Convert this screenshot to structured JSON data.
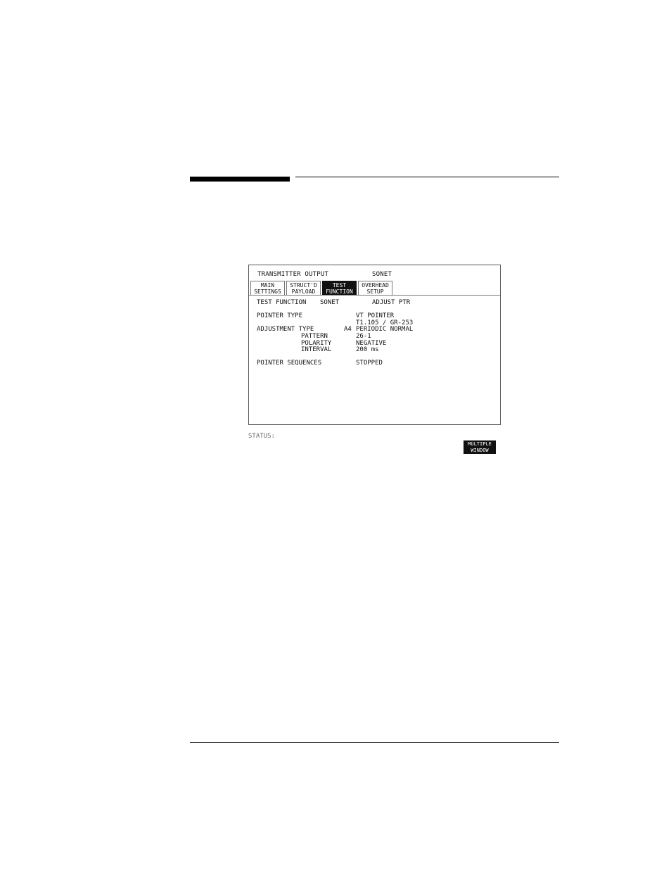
{
  "window": {
    "title": "TRANSMITTER OUTPUT",
    "mode": "SONET"
  },
  "tabs": [
    {
      "line1": "MAIN",
      "line2": "SETTINGS",
      "active": false
    },
    {
      "line1": "STRUCT'D",
      "line2": "PAYLOAD",
      "active": false
    },
    {
      "line1": "TEST",
      "line2": "FUNCTION",
      "active": true
    },
    {
      "line1": "OVERHEAD",
      "line2": "SETUP",
      "active": false
    }
  ],
  "test_function": {
    "label": "TEST FUNCTION",
    "type": "SONET",
    "value": "ADJUST PTR"
  },
  "pointer_type": {
    "label": "POINTER TYPE",
    "value": "VT POINTER",
    "standard": "T1.105 / GR-253"
  },
  "adjustment_type": {
    "label": "ADJUSTMENT TYPE",
    "code": "A4",
    "value": "PERIODIC NORMAL"
  },
  "pattern": {
    "label": "PATTERN",
    "value": "26-1"
  },
  "polarity": {
    "label": "POLARITY",
    "value": "NEGATIVE"
  },
  "interval": {
    "label": "INTERVAL",
    "value": "200 ms"
  },
  "pointer_sequences": {
    "label": "POINTER SEQUENCES",
    "value": "STOPPED"
  },
  "status": {
    "label": "STATUS:"
  },
  "multiple_window": {
    "line1": "MULTIPLE",
    "line2": "WINDOW"
  }
}
